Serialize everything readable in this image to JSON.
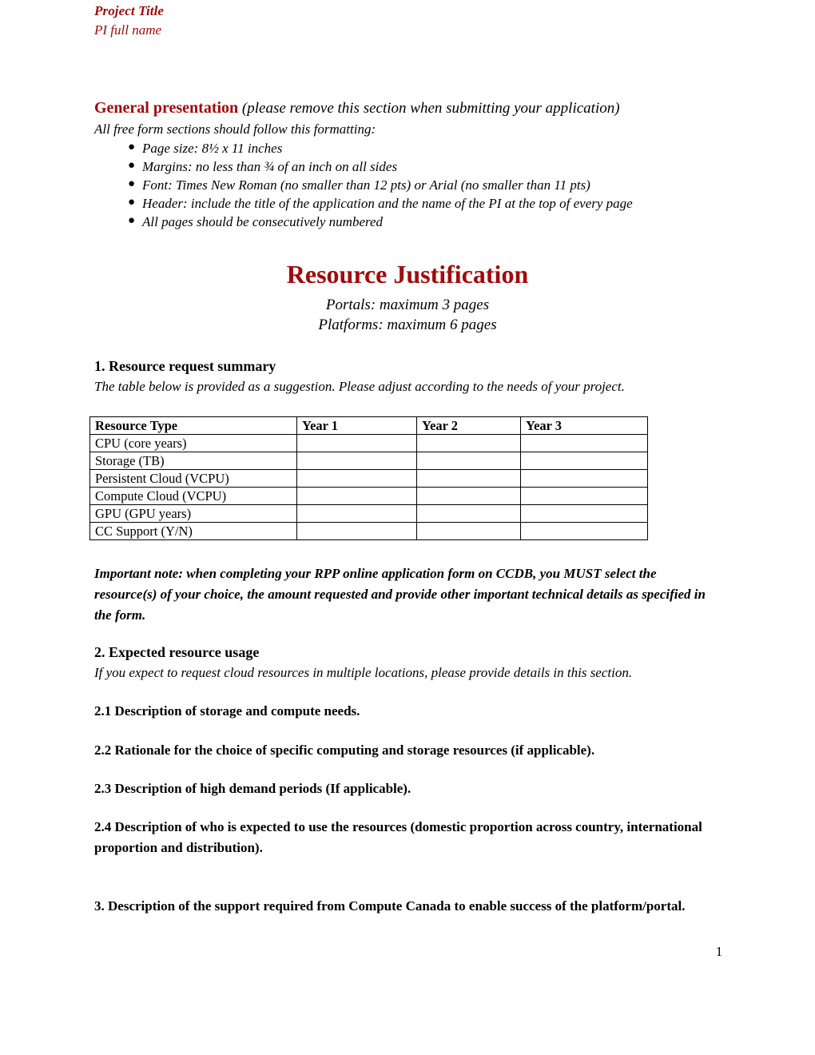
{
  "header": {
    "project_title": "Project Title",
    "pi_name": "PI full name"
  },
  "general_presentation": {
    "heading_strong": "General presentation",
    "heading_rest": " (please remove this section when submitting your application)",
    "intro": "All free form sections should follow this formatting:",
    "bullet_glyph": "●",
    "bullets": [
      "Page size: 8½ x 11 inches",
      "Margins: no less than ¾ of an inch on all sides",
      "Font: Times New Roman (no smaller than 12 pts) or Arial (no smaller than 11 pts)",
      "Header: include the title of the application and the name of the PI at the top of every page",
      "All pages should be consecutively numbered"
    ]
  },
  "title_block": {
    "title": "Resource Justification",
    "subtitle_1": "Portals: maximum 3 pages",
    "subtitle_2": "Platforms: maximum 6 pages"
  },
  "section_1": {
    "heading": "1. Resource request summary",
    "note": "The table below is provided as a suggestion. Please adjust according to the needs of your project."
  },
  "resource_table": {
    "columns": [
      "Resource Type",
      "Year 1",
      "Year 2",
      "Year 3"
    ],
    "rows": [
      {
        "label": "CPU (core years)",
        "year_1": "",
        "year_2": "",
        "year_3": ""
      },
      {
        "label": "Storage (TB)",
        "year_1": "",
        "year_2": "",
        "year_3": ""
      },
      {
        "label": "Persistent Cloud (VCPU)",
        "year_1": "",
        "year_2": "",
        "year_3": ""
      },
      {
        "label": "Compute Cloud (VCPU)",
        "year_1": "",
        "year_2": "",
        "year_3": ""
      },
      {
        "label": "GPU (GPU years)",
        "year_1": "",
        "year_2": "",
        "year_3": ""
      },
      {
        "label": "CC Support (Y/N)",
        "year_1": "",
        "year_2": "",
        "year_3": ""
      }
    ]
  },
  "important_note": {
    "text": "Important note: when completing your RPP online application form on CCDB, you MUST select the resource(s) of your choice, the amount requested and provide other important technical details as specified in the form."
  },
  "section_2": {
    "heading": "2. Expected resource usage",
    "note": "If you expect to request cloud resources in multiple locations, please provide details in this section.",
    "subsections": [
      {
        "id": "2.1",
        "text": "2.1 Description of storage and compute needs."
      },
      {
        "id": "2.2",
        "text": "2.2 Rationale for the choice of specific computing and storage resources (if applicable)."
      },
      {
        "id": "2.3",
        "text": "2.3 Description of high demand periods (If applicable)."
      },
      {
        "id": "2.4",
        "text": "2.4 Description of who is expected to use the resources (domestic proportion across country, international proportion and distribution)."
      }
    ]
  },
  "section_3": {
    "heading": "3. Description of the support required from Compute Canada to enable success of the platform/portal."
  },
  "footer": {
    "page_number": "1"
  },
  "colors": {
    "accent_red": "#A00B0B",
    "text": "#000000",
    "background": "#FFFFFF"
  }
}
